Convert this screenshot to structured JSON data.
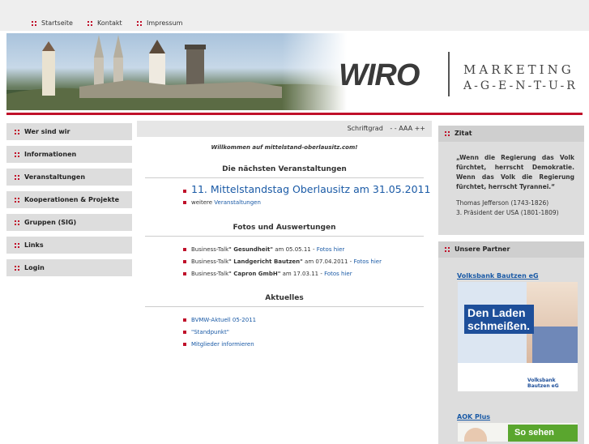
{
  "topnav": {
    "items": [
      "Startseite",
      "Kontakt",
      "Impressum"
    ]
  },
  "logo": {
    "brand": "WIRO",
    "line1": "MARKETING",
    "line2": "A-G-E-N-T-U-R"
  },
  "colors": {
    "accent": "#c0102a",
    "link": "#1a5aa6"
  },
  "sidebar": {
    "items": [
      "Wer sind wir",
      "Informationen",
      "Veranstaltungen",
      "Kooperationen & Projekte",
      "Gruppen (SIG)",
      "Links",
      "Login"
    ]
  },
  "fontbar": {
    "label": "Schriftgrad",
    "controls": "- - AAA ++"
  },
  "main": {
    "welcome": "Willkommen auf mittelstand-oberlausitz.com!",
    "events_title": "Die nächsten Veranstaltungen",
    "event": "11. Mittelstandstag Oberlausitz am 31.05.2011",
    "more_prefix": "weitere",
    "more_link": "Veranstaltungen",
    "photos_title": "Fotos und Auswertungen",
    "photos": [
      {
        "prefix": "Business-Talk",
        "name": "\" Gesundheit\"",
        "date": "am 05.05.11 -",
        "link": "Fotos hier"
      },
      {
        "prefix": "Business-Talk",
        "name": "\" Landgericht Bautzen\"",
        "date": "am 07.04.2011 -",
        "link": "Fotos hier"
      },
      {
        "prefix": "Business-Talk",
        "name": "\" Capron GmbH\"",
        "date": "am 17.03.11 -",
        "link": "Fotos hier"
      }
    ],
    "news_title": "Aktuelles",
    "news": [
      "BVMW-Aktuell 05-2011",
      "\"Standpunkt\"",
      "Mitglieder informieren"
    ]
  },
  "right": {
    "quote_title": "Zitat",
    "quote": "„Wenn die Regierung das Volk fürchtet, herrscht Demokratie. Wenn das Volk die Regierung fürchtet, herrscht Tyrannei.“",
    "author": "Thomas Jefferson (1743-1826)",
    "author_desc": "3. Präsident der USA (1801-1809)",
    "partner_title": "Unsere Partner",
    "partner1": "Volksbank Bautzen eG",
    "ad1_text": "Den Laden schmeißen.",
    "ad1_bank": "Volksbank Bautzen eG",
    "partner2": "AOK Plus",
    "ad2_text": "So sehen"
  }
}
